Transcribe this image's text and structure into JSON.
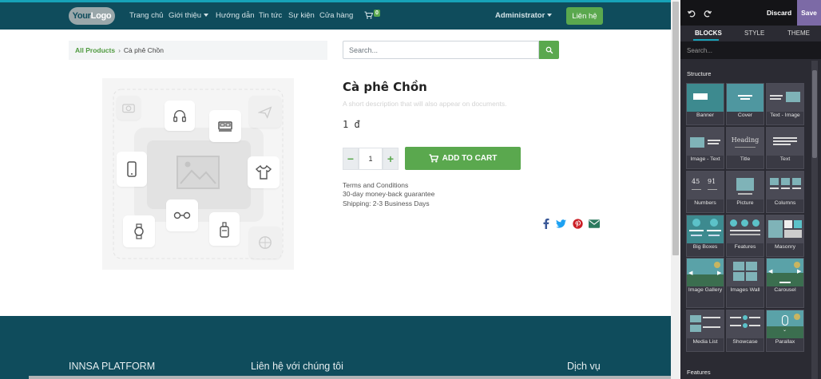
{
  "navbar": {
    "logo_text_a": "Your",
    "logo_text_b": "Logo",
    "links": [
      "Trang chủ",
      "Giới thiệu",
      "Hướng dẫn",
      "Tin tức",
      "Sự kiện",
      "Cửa hàng"
    ],
    "cart_count": "0",
    "user": "Administrator",
    "contact_button": "Liên hệ"
  },
  "breadcrumb": {
    "parent": "All Products",
    "separator": "›",
    "current": "Cà phê Chồn"
  },
  "search": {
    "placeholder": "Search..."
  },
  "product": {
    "name": "Cà phê Chồn",
    "description": "A short description that will also appear on documents.",
    "price": "1 đ",
    "quantity": "1",
    "add_to_cart": "ADD TO CART",
    "terms": [
      "Terms and Conditions",
      "30-day money-back guarantee",
      "Shipping: 2-3 Business Days"
    ]
  },
  "share": {
    "icons": [
      "facebook-icon",
      "twitter-icon",
      "pinterest-icon",
      "email-icon"
    ],
    "colors": {
      "facebook": "#3b5998",
      "twitter": "#1da1f2",
      "pinterest": "#cb2027",
      "email": "#2b7a5e"
    }
  },
  "footer": {
    "col1": "INNSA PLATFORM",
    "col2": "Liên hệ với chúng tôi",
    "col3": "Dịch vụ"
  },
  "editor": {
    "discard": "Discard",
    "save": "Save",
    "tabs": [
      "BLOCKS",
      "STYLE",
      "THEME"
    ],
    "search_placeholder": "Search...",
    "section_structure": "Structure",
    "section_features": "Features",
    "snippets": [
      "Banner",
      "Cover",
      "Text - Image",
      "Image - Text",
      "Title",
      "Text",
      "Numbers",
      "Picture",
      "Columns",
      "Big Boxes",
      "Features",
      "Masonry",
      "Image Gallery",
      "Images Wall",
      "Carousel",
      "Media List",
      "Showcase",
      "Parallax"
    ],
    "title_thumb": "Heading",
    "numbers_thumb": [
      "45",
      "91"
    ]
  },
  "colors": {
    "navbar": "#0f4c5c",
    "accent_green": "#5aa84e",
    "editor_bg": "#2b2b33",
    "save_purple": "#7c6aa6"
  }
}
